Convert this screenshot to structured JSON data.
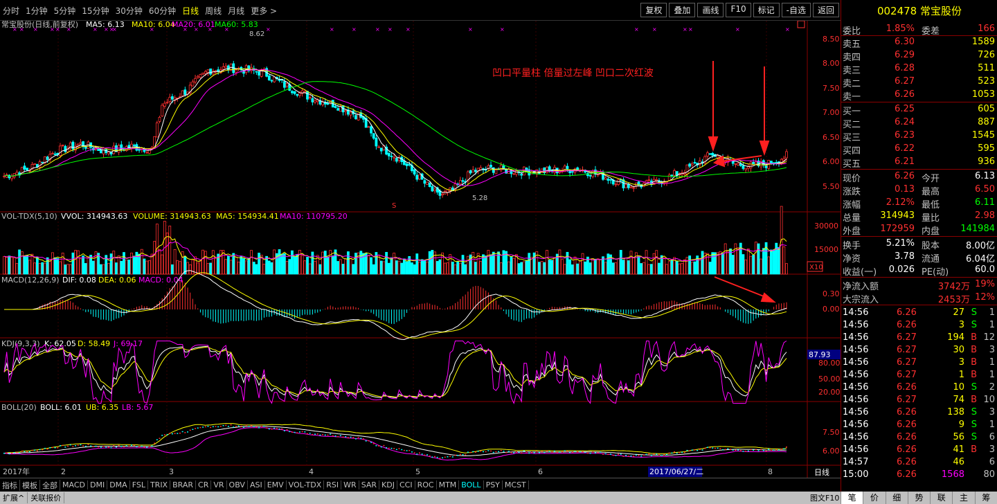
{
  "toolbar": {
    "periods": [
      "分时",
      "1分钟",
      "5分钟",
      "15分钟",
      "30分钟",
      "60分钟",
      "日线",
      "周线",
      "月线",
      "更多 >"
    ],
    "active_period": 6,
    "buttons": [
      "复权",
      "叠加",
      "画线",
      "F10",
      "标记",
      "-自选",
      "返回"
    ]
  },
  "main": {
    "legend": {
      "name": "常宝股份(日线,前复权)",
      "ma5": "MA5: 6.13",
      "ma10": "MA10: 6.04",
      "ma20": "MA20: 6.01",
      "ma60": "MA60: 5.83"
    },
    "high_label": "8.62",
    "low_label": "5.28",
    "annotation": "凹口平量柱 倍量过左峰 凹口二次红波",
    "s_marker": "S",
    "yaxis": [
      "8.50",
      "8.00",
      "7.50",
      "7.00",
      "6.50",
      "6.00",
      "5.50"
    ]
  },
  "vol": {
    "legend": {
      "name": "VOL-TDX(5,10)",
      "vvol": "VVOL: 314943.63",
      "volume": "VOLUME: 314943.63",
      "ma5": "MA5: 154934.41",
      "ma10": "MA10: 110795.20"
    },
    "yaxis": [
      "30000",
      "15000"
    ],
    "unit": "X10"
  },
  "macd": {
    "legend": {
      "name": "MACD(12,26,9)",
      "dif": "DIF: 0.08",
      "dea": "DEA: 0.06",
      "macd": "MACD: 0.04"
    },
    "yaxis": [
      "0.30",
      "0.00"
    ]
  },
  "kdj": {
    "legend": {
      "name": "KDJ(9,3,3)",
      "k": "K: 62.05",
      "d": "D: 58.49",
      "j": "J: 69.17"
    },
    "yaxis": [
      "80.00",
      "50.00",
      "20.00"
    ],
    "value_box": "87.93"
  },
  "boll": {
    "legend": {
      "name": "BOLL(20)",
      "boll": "BOLL: 6.01",
      "ub": "UB: 6.35",
      "lb": "LB: 5.67"
    },
    "yaxis": [
      "7.50",
      "6.00"
    ]
  },
  "xaxis": {
    "labels": [
      "2017年",
      "2",
      "3",
      "4",
      "5",
      "6",
      "8"
    ],
    "cursor_date": "2017/06/27/二",
    "period_label": "日线"
  },
  "bottom_tabs": [
    "指标",
    "模板",
    "全部",
    "MACD",
    "DMI",
    "DMA",
    "FSL",
    "TRIX",
    "BRAR",
    "CR",
    "VR",
    "OBV",
    "ASI",
    "EMV",
    "VOL-TDX",
    "RSI",
    "WR",
    "SAR",
    "KDJ",
    "CCI",
    "ROC",
    "MTM",
    "BOLL",
    "PSY",
    "MCST"
  ],
  "active_bottom_tab": "BOLL",
  "status": [
    "扩展^",
    "关联报价"
  ],
  "status_right": "图文F10",
  "panel": {
    "code": "002478",
    "name": "常宝股份",
    "weibi": {
      "l1": "委比",
      "v1": "1.85%",
      "l2": "委差",
      "v2": "166"
    },
    "sells": [
      {
        "label": "卖五",
        "price": "6.30",
        "vol": "1589"
      },
      {
        "label": "卖四",
        "price": "6.29",
        "vol": "726"
      },
      {
        "label": "卖三",
        "price": "6.28",
        "vol": "511"
      },
      {
        "label": "卖二",
        "price": "6.27",
        "vol": "523"
      },
      {
        "label": "卖一",
        "price": "6.26",
        "vol": "1053"
      }
    ],
    "buys": [
      {
        "label": "买一",
        "price": "6.25",
        "vol": "605"
      },
      {
        "label": "买二",
        "price": "6.24",
        "vol": "887"
      },
      {
        "label": "买三",
        "price": "6.23",
        "vol": "1545"
      },
      {
        "label": "买四",
        "price": "6.22",
        "vol": "595"
      },
      {
        "label": "买五",
        "price": "6.21",
        "vol": "936"
      }
    ],
    "quote": [
      {
        "l1": "现价",
        "v1": "6.26",
        "c1": "#ff3030",
        "l2": "今开",
        "v2": "6.13",
        "c2": "#ffffff"
      },
      {
        "l1": "涨跌",
        "v1": "0.13",
        "c1": "#ff3030",
        "l2": "最高",
        "v2": "6.50",
        "c2": "#ff3030"
      },
      {
        "l1": "涨幅",
        "v1": "2.12%",
        "c1": "#ff3030",
        "l2": "最低",
        "v2": "6.11",
        "c2": "#00ff00"
      },
      {
        "l1": "总量",
        "v1": "314943",
        "c1": "#ffff00",
        "l2": "量比",
        "v2": "2.98",
        "c2": "#ff3030"
      },
      {
        "l1": "外盘",
        "v1": "172959",
        "c1": "#ff3030",
        "l2": "内盘",
        "v2": "141984",
        "c2": "#00ff00"
      }
    ],
    "info": [
      {
        "l1": "换手",
        "v1": "5.21%",
        "l2": "股本",
        "v2": "8.00亿"
      },
      {
        "l1": "净资",
        "v1": "3.78",
        "l2": "流通",
        "v2": "6.04亿"
      },
      {
        "l1": "收益(一)",
        "v1": "0.026",
        "l2": "PE(动)",
        "v2": "60.0"
      }
    ],
    "flows": [
      {
        "label": "净流入额",
        "v1": "3742万",
        "v2": "19%"
      },
      {
        "label": "大宗流入",
        "v1": "2453万",
        "v2": "12%"
      }
    ],
    "ticks": [
      {
        "time": "14:56",
        "price": "6.26",
        "vol": "27",
        "side": "S",
        "n": "1"
      },
      {
        "time": "14:56",
        "price": "6.26",
        "vol": "3",
        "side": "S",
        "n": "1"
      },
      {
        "time": "14:56",
        "price": "6.27",
        "vol": "194",
        "side": "B",
        "n": "12"
      },
      {
        "time": "14:56",
        "price": "6.27",
        "vol": "30",
        "side": "B",
        "n": "3"
      },
      {
        "time": "14:56",
        "price": "6.27",
        "vol": "3",
        "side": "B",
        "n": "1"
      },
      {
        "time": "14:56",
        "price": "6.27",
        "vol": "1",
        "side": "B",
        "n": "1"
      },
      {
        "time": "14:56",
        "price": "6.26",
        "vol": "10",
        "side": "S",
        "n": "2"
      },
      {
        "time": "14:56",
        "price": "6.27",
        "vol": "74",
        "side": "B",
        "n": "10"
      },
      {
        "time": "14:56",
        "price": "6.26",
        "vol": "138",
        "side": "S",
        "n": "3"
      },
      {
        "time": "14:56",
        "price": "6.26",
        "vol": "9",
        "side": "S",
        "n": "1"
      },
      {
        "time": "14:56",
        "price": "6.26",
        "vol": "56",
        "side": "S",
        "n": "6"
      },
      {
        "time": "14:56",
        "price": "6.26",
        "vol": "41",
        "side": "B",
        "n": "3"
      },
      {
        "time": "14:57",
        "price": "6.26",
        "vol": "46",
        "side": "",
        "n": "6"
      },
      {
        "time": "15:00",
        "price": "6.26",
        "vol": "1568",
        "side": "",
        "n": "80"
      }
    ],
    "tabs": [
      "笔",
      "价",
      "细",
      "势",
      "联",
      "主",
      "筹"
    ]
  }
}
